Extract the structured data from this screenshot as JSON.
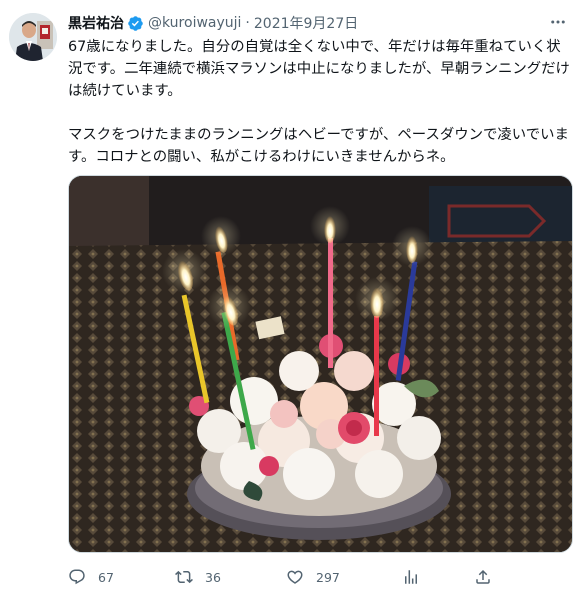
{
  "tweet": {
    "display_name": "黒岩祐治",
    "handle": "@kuroiwayuji",
    "separator": "·",
    "date": "2021年9月27日",
    "paragraph_1": "67歳になりました。自分の自覚は全くない中で、年だけは毎年重ねていく状況です。二年連続で横浜マラソンは中止になりましたが、早朝ランニングだけは続けています。",
    "paragraph_2": "マスクをつけたままのランニングはヘビーですが、ペースダウンで凌いでいます。コロナとの闘い、私がこけるわけにいきませんからネ。",
    "more_icon": "more-icon",
    "verified_icon": "verified-badge-icon",
    "verified_color": "#1d9bf0"
  },
  "actions": {
    "reply_count": "67",
    "retweet_count": "36",
    "like_count": "297",
    "reply_icon": "reply-icon",
    "retweet_icon": "retweet-icon",
    "like_icon": "heart-icon",
    "stats_icon": "stats-icon",
    "share_icon": "share-icon"
  },
  "colors": {
    "text": "#0f1419",
    "secondary": "#536471",
    "border": "#cfd9de"
  }
}
